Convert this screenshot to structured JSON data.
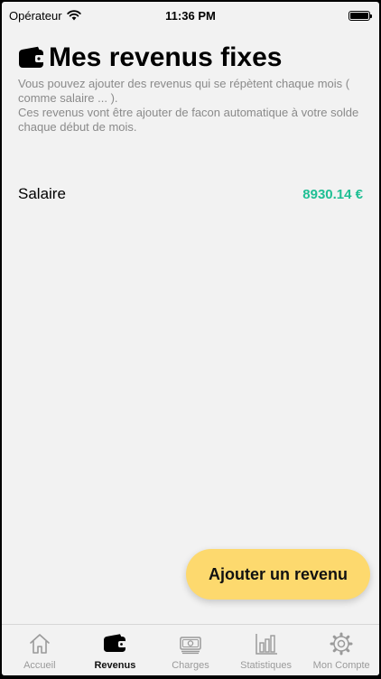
{
  "status_bar": {
    "carrier": "Opérateur",
    "time": "11:36 PM"
  },
  "header": {
    "icon": "wallet-icon",
    "title": "Mes revenus fixes",
    "description_line1": "Vous pouvez ajouter des revenus qui se répètent chaque mois ( comme salaire ... ).",
    "description_line2": "Ces revenus vont être ajouter de facon automatique à votre solde chaque début de mois."
  },
  "incomes": [
    {
      "name": "Salaire",
      "amount": "8930.14 €"
    }
  ],
  "add_button_label": "Ajouter un revenu",
  "tabs": [
    {
      "label": "Accueil",
      "icon": "home-icon",
      "active": false
    },
    {
      "label": "Revenus",
      "icon": "wallet-icon",
      "active": true
    },
    {
      "label": "Charges",
      "icon": "banknote-icon",
      "active": false
    },
    {
      "label": "Statistiques",
      "icon": "bar-chart-icon",
      "active": false
    },
    {
      "label": "Mon Compte",
      "icon": "gear-icon",
      "active": false
    }
  ],
  "colors": {
    "background": "#f2f2f2",
    "accent_button": "#fdd96e",
    "amount_green": "#1fbf94",
    "inactive_tab": "#9a9a9a"
  }
}
